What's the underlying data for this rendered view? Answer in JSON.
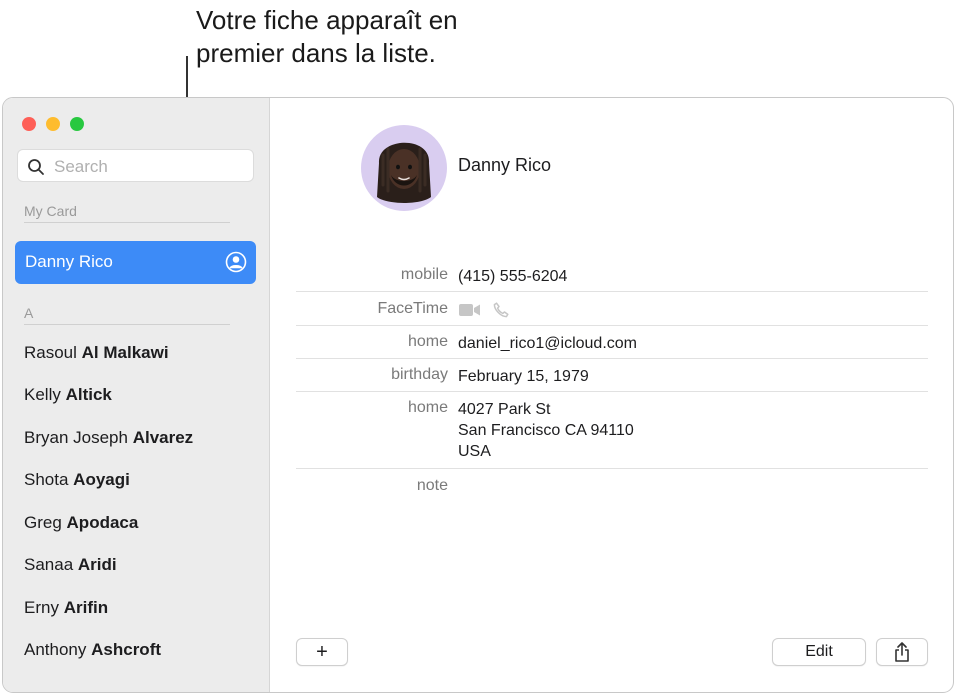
{
  "callout": {
    "line1": "Votre fiche apparaît en",
    "line2": "premier dans la liste."
  },
  "search": {
    "placeholder": "Search"
  },
  "sidebar": {
    "my_card_label": "My Card",
    "selected": {
      "name": "Danny Rico"
    },
    "section_a": "A",
    "contacts": [
      {
        "first": "Rasoul",
        "last": "Al Malkawi"
      },
      {
        "first": "Kelly",
        "last": "Altick"
      },
      {
        "first": "Bryan Joseph",
        "last": "Alvarez"
      },
      {
        "first": "Shota",
        "last": "Aoyagi"
      },
      {
        "first": "Greg",
        "last": "Apodaca"
      },
      {
        "first": "Sanaa",
        "last": "Aridi"
      },
      {
        "first": "Erny",
        "last": "Arifin"
      },
      {
        "first": "Anthony",
        "last": "Ashcroft"
      }
    ]
  },
  "detail": {
    "name": "Danny Rico",
    "fields": {
      "mobile": {
        "label": "mobile",
        "value": "(415) 555-6204"
      },
      "facetime": {
        "label": "FaceTime"
      },
      "email": {
        "label": "home",
        "value": "daniel_rico1@icloud.com"
      },
      "birthday": {
        "label": "birthday",
        "value": "February 15, 1979"
      },
      "address": {
        "label": "home",
        "line1": "4027 Park St",
        "line2": "San Francisco CA 94110",
        "line3": "USA"
      },
      "note": {
        "label": "note"
      }
    },
    "buttons": {
      "add": "+",
      "edit": "Edit"
    }
  },
  "colors": {
    "accent": "#3d8bf7",
    "sidebar_bg": "#ececec"
  },
  "icons": [
    "search-icon",
    "me-card-icon",
    "video-icon",
    "phone-icon",
    "share-icon"
  ]
}
